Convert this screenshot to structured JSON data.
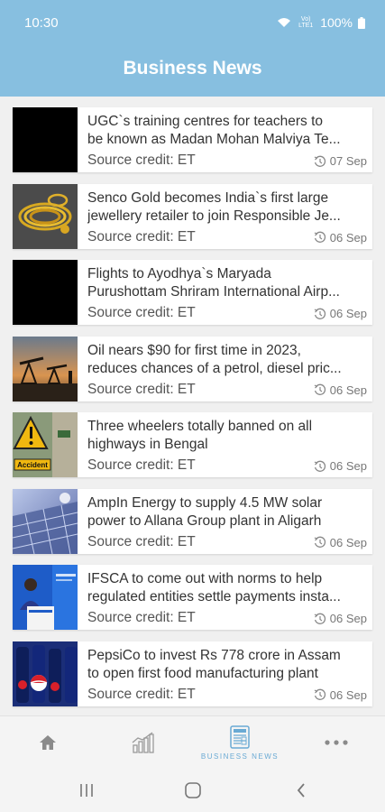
{
  "status_bar": {
    "time": "10:30",
    "network": "Vo) LTE1",
    "battery": "100%"
  },
  "header": {
    "title": "Business News"
  },
  "articles": [
    {
      "title_line1": "UGC`s training centres for teachers to",
      "title_line2": "be known as Madan Mohan Malviya Te...",
      "source": "Source credit: ET",
      "date": "07 Sep",
      "thumb": "black-thumbnail"
    },
    {
      "title_line1": "Senco Gold becomes India`s first large",
      "title_line2": "jewellery retailer to join Responsible Je...",
      "source": "Source credit: ET",
      "date": "06 Sep",
      "thumb": "gold-jewellery-photo"
    },
    {
      "title_line1": "Flights to Ayodhya`s Maryada",
      "title_line2": "Purushottam Shriram International Airp...",
      "source": "Source credit: ET",
      "date": "06 Sep",
      "thumb": "black-thumbnail"
    },
    {
      "title_line1": "Oil nears $90 for first time in 2023,",
      "title_line2": "reduces chances of a petrol, diesel pric...",
      "source": "Source credit: ET",
      "date": "06 Sep",
      "thumb": "oil-pumps-photo"
    },
    {
      "title_line1": "Three wheelers totally banned on all",
      "title_line2": "highways in Bengal",
      "source": "Source credit: ET",
      "date": "06 Sep",
      "thumb": "accident-sign-photo"
    },
    {
      "title_line1": "AmpIn Energy to supply 4.5 MW solar",
      "title_line2": "power to Allana Group plant in Aligarh",
      "source": "Source credit: ET",
      "date": "06 Sep",
      "thumb": "solar-panels-photo"
    },
    {
      "title_line1": "IFSCA to come out with norms to help",
      "title_line2": "regulated entities settle payments insta...",
      "source": "Source credit: ET",
      "date": "06 Sep",
      "thumb": "speaker-podium-photo"
    },
    {
      "title_line1": "PepsiCo to invest Rs 778 crore in Assam",
      "title_line2": "to open first food manufacturing plant",
      "source": "Source credit: ET",
      "date": "06 Sep",
      "thumb": "pepsi-bottles-photo"
    }
  ],
  "accident_sign_text": "Accident",
  "bottom_nav": {
    "items": [
      {
        "id": "home",
        "icon": "home-icon",
        "label": ""
      },
      {
        "id": "markets",
        "icon": "chart-icon",
        "label": ""
      },
      {
        "id": "business-news",
        "icon": "newspaper-icon",
        "label": "BUSINESS NEWS"
      },
      {
        "id": "more",
        "icon": "more-icon",
        "label": ""
      }
    ]
  },
  "colors": {
    "header": "#87bfe0",
    "active_nav": "#6aaad4",
    "background": "#f0f0f0"
  }
}
